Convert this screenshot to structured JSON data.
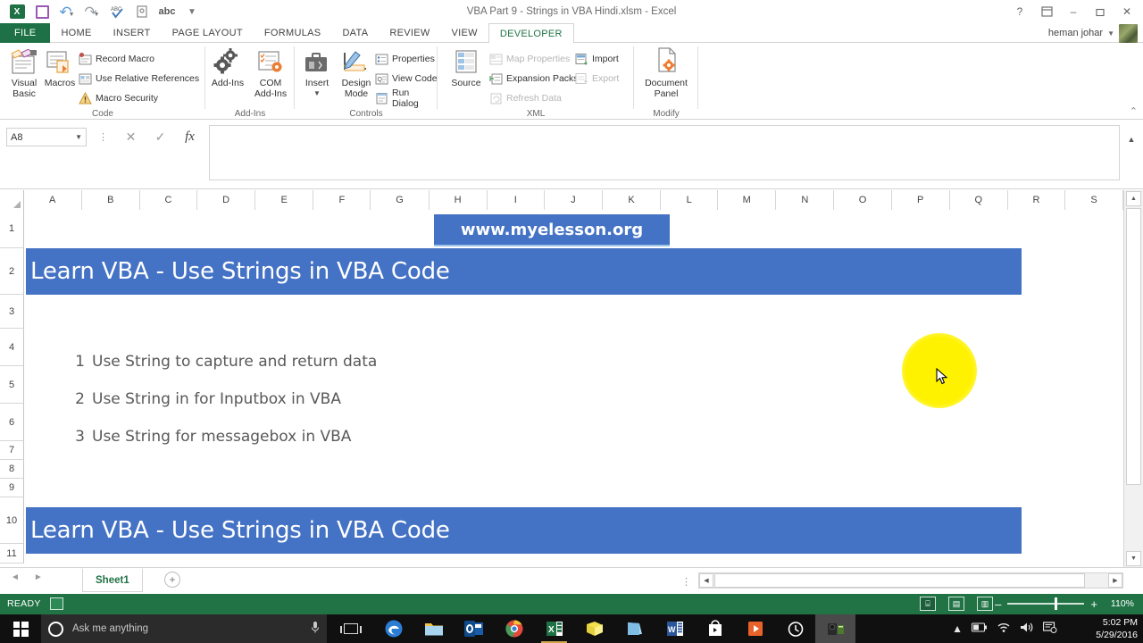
{
  "window": {
    "title": "VBA Part 9 -  Strings in VBA Hindi.xlsm - Excel",
    "user": "heman johar",
    "help_icon": "?",
    "ribbon_display_icon": "ribbon-display-options-icon",
    "minimize_icon": "–",
    "restore_icon": "❐",
    "close_icon": "✕"
  },
  "quick_access": {
    "items": [
      {
        "name": "excel-logo",
        "label": "X"
      },
      {
        "name": "save-icon",
        "label": ""
      },
      {
        "name": "undo-icon",
        "label": "↶"
      },
      {
        "name": "redo-icon",
        "label": "↷"
      },
      {
        "name": "spelling-icon",
        "label": "ABC"
      },
      {
        "name": "print-preview-icon",
        "label": ""
      },
      {
        "name": "abc-icon",
        "label": "abc"
      },
      {
        "name": "customize-qat-icon",
        "label": "≡"
      }
    ]
  },
  "ribbon": {
    "tabs": [
      {
        "label": "FILE",
        "active": false,
        "file": true
      },
      {
        "label": "HOME",
        "active": false
      },
      {
        "label": "INSERT",
        "active": false
      },
      {
        "label": "PAGE LAYOUT",
        "active": false
      },
      {
        "label": "FORMULAS",
        "active": false
      },
      {
        "label": "DATA",
        "active": false
      },
      {
        "label": "REVIEW",
        "active": false
      },
      {
        "label": "VIEW",
        "active": false
      },
      {
        "label": "DEVELOPER",
        "active": true
      }
    ],
    "collapse_label": "⌃",
    "groups": {
      "code": {
        "label": "Code",
        "visual_basic": "Visual\nBasic",
        "visual_basic_line1": "Visual",
        "visual_basic_line2": "Basic",
        "macros": "Macros",
        "record_macro": "Record Macro",
        "use_relative_references": "Use Relative References",
        "macro_security": "Macro Security"
      },
      "addins": {
        "label": "Add-Ins",
        "add_ins": "Add-Ins",
        "com_line1": "COM",
        "com_line2": "Add-Ins"
      },
      "controls": {
        "label": "Controls",
        "insert": "Insert",
        "design_line1": "Design",
        "design_line2": "Mode",
        "properties": "Properties",
        "view_code": "View Code",
        "run_dialog": "Run Dialog"
      },
      "xml": {
        "label": "XML",
        "source": "Source",
        "map_properties": "Map Properties",
        "expansion_packs": "Expansion Packs",
        "refresh_data": "Refresh Data",
        "import": "Import",
        "export": "Export"
      },
      "modify": {
        "label": "Modify",
        "document_line1": "Document",
        "document_line2": "Panel"
      }
    }
  },
  "formula_bar": {
    "name_box_value": "A8",
    "cancel_icon": "✕",
    "enter_icon": "✓",
    "function_icon": "fx",
    "formula_value": "",
    "expand_icon": "▲"
  },
  "grid": {
    "columns": [
      "A",
      "B",
      "C",
      "D",
      "E",
      "F",
      "G",
      "H",
      "I",
      "J",
      "K",
      "L",
      "M",
      "N",
      "O",
      "P",
      "Q",
      "R",
      "S"
    ],
    "rows": [
      "1",
      "2",
      "3",
      "4",
      "5",
      "6",
      "7",
      "8",
      "9",
      "10",
      "11"
    ],
    "url_banner": "www.myelesson.org",
    "title_banner_row2": "Learn VBA - Use Strings in VBA Code",
    "title_banner_row10": "Learn VBA - Use Strings in VBA Code",
    "list": [
      {
        "num": "1",
        "text": "Use String to capture and return data"
      },
      {
        "num": "2",
        "text": "Use String in for Inputbox in VBA"
      },
      {
        "num": "3",
        "text": "Use String for messagebox in VBA"
      }
    ],
    "accent_blue": "#4472c4",
    "text_gray": "#595959"
  },
  "sheet_tabs": {
    "prev_icon": "◄",
    "next_icon": "►",
    "tabs": [
      {
        "label": "Sheet1",
        "active": true
      }
    ],
    "add_icon": "+"
  },
  "status_bar": {
    "status": "READY",
    "macro_record_icon": "record-macro-icon",
    "views": [
      {
        "name": "normal-view-button",
        "icon": "⌸",
        "active": true
      },
      {
        "name": "page-layout-view-button",
        "icon": "▤",
        "active": false
      },
      {
        "name": "page-break-preview-button",
        "icon": "▥",
        "active": false
      }
    ],
    "zoom_out_icon": "–",
    "zoom_in_icon": "+",
    "zoom_level": "110%"
  },
  "taskbar": {
    "start_icon": "windows-logo-icon",
    "search_placeholder": "Ask me anything",
    "mic_icon": "🎤",
    "task_view_icon": "task-view-icon",
    "apps": [
      {
        "name": "edge-icon",
        "glyph": "e",
        "color": "#2b7cd3",
        "running": false
      },
      {
        "name": "file-explorer-icon",
        "glyph": "▤",
        "color": "#f0c14b",
        "running": false
      },
      {
        "name": "outlook-icon",
        "glyph": "O",
        "color": "#1a5ca8",
        "running": false
      },
      {
        "name": "chrome-icon",
        "glyph": "●",
        "color": "#e24b3b",
        "running": false
      },
      {
        "name": "excel-icon",
        "glyph": "X",
        "color": "#1e7145",
        "running": true
      },
      {
        "name": "sticky-notes-icon",
        "glyph": "■",
        "color": "#f2e14c",
        "running": false
      },
      {
        "name": "onedrive-icon",
        "glyph": "▰",
        "color": "#5aa7dd",
        "running": false
      },
      {
        "name": "word-icon",
        "glyph": "W",
        "color": "#2b579a",
        "running": false
      },
      {
        "name": "store-icon",
        "glyph": "▣",
        "color": "#ffffff",
        "running": false
      },
      {
        "name": "movies-tv-icon",
        "glyph": "▶",
        "color": "#e8622a",
        "running": false
      },
      {
        "name": "alarms-clock-icon",
        "glyph": "◔",
        "color": "#ffffff",
        "running": false
      },
      {
        "name": "camtasia-icon",
        "glyph": "◆",
        "color": "#7ea64a",
        "running": false,
        "active": true
      }
    ],
    "tray": [
      "▲",
      "▭",
      "◔",
      "◁",
      "⚑"
    ],
    "time": "5:02 PM",
    "date": "5/29/2016"
  }
}
